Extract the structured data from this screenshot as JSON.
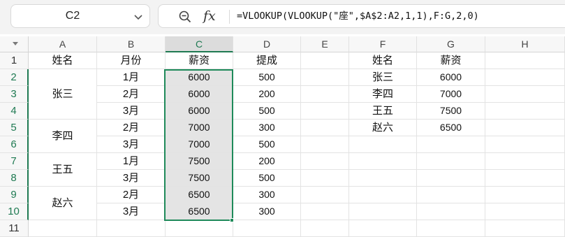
{
  "name_box": {
    "value": "C2"
  },
  "formula_bar": {
    "value": "=VLOOKUP(VLOOKUP(\"座\",$A$2:A2,1,1),F:G,2,0)"
  },
  "columns": [
    "A",
    "B",
    "C",
    "D",
    "E",
    "F",
    "G",
    "H"
  ],
  "rows": [
    "1",
    "2",
    "3",
    "4",
    "5",
    "6",
    "7",
    "8",
    "9",
    "10",
    "11"
  ],
  "selected": {
    "column": "C",
    "rows": [
      "2",
      "3",
      "4",
      "5",
      "6",
      "7",
      "8",
      "9",
      "10"
    ]
  },
  "sheet": {
    "a": {
      "header": "姓名",
      "groups": [
        "张三",
        "李四",
        "王五",
        "赵六"
      ]
    },
    "b": {
      "header": "月份",
      "values": [
        "1月",
        "2月",
        "3月",
        "2月",
        "3月",
        "1月",
        "3月",
        "2月",
        "3月"
      ]
    },
    "c": {
      "header": "薪资",
      "values": [
        "6000",
        "6000",
        "6000",
        "7000",
        "7000",
        "7500",
        "7500",
        "6500",
        "6500"
      ]
    },
    "d": {
      "header": "提成",
      "values": [
        "500",
        "200",
        "500",
        "300",
        "500",
        "200",
        "500",
        "300",
        "300"
      ]
    },
    "f": {
      "header": "姓名",
      "values": [
        "张三",
        "李四",
        "王五",
        "赵六"
      ]
    },
    "g": {
      "header": "薪资",
      "values": [
        "6000",
        "7000",
        "7500",
        "6500"
      ]
    }
  }
}
